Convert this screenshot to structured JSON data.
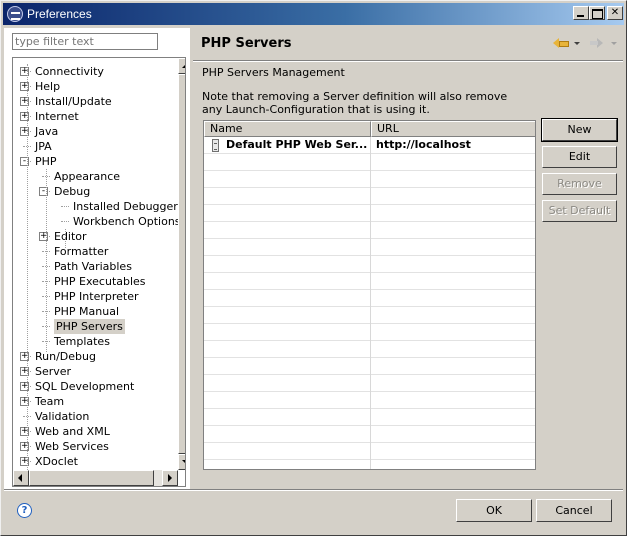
{
  "window": {
    "title": "Preferences"
  },
  "filter": {
    "placeholder": "type filter text"
  },
  "tree": [
    {
      "label": "Connectivity",
      "level": 0,
      "toggle": "+"
    },
    {
      "label": "Help",
      "level": 0,
      "toggle": "+"
    },
    {
      "label": "Install/Update",
      "level": 0,
      "toggle": "+"
    },
    {
      "label": "Internet",
      "level": 0,
      "toggle": "+"
    },
    {
      "label": "Java",
      "level": 0,
      "toggle": "+"
    },
    {
      "label": "JPA",
      "level": 0,
      "toggle": ""
    },
    {
      "label": "PHP",
      "level": 0,
      "toggle": "-"
    },
    {
      "label": "Appearance",
      "level": 1,
      "toggle": ""
    },
    {
      "label": "Debug",
      "level": 1,
      "toggle": "-"
    },
    {
      "label": "Installed Debuggers",
      "level": 2,
      "toggle": ""
    },
    {
      "label": "Workbench Options",
      "level": 2,
      "toggle": ""
    },
    {
      "label": "Editor",
      "level": 1,
      "toggle": "+"
    },
    {
      "label": "Formatter",
      "level": 1,
      "toggle": ""
    },
    {
      "label": "Path Variables",
      "level": 1,
      "toggle": ""
    },
    {
      "label": "PHP Executables",
      "level": 1,
      "toggle": ""
    },
    {
      "label": "PHP Interpreter",
      "level": 1,
      "toggle": ""
    },
    {
      "label": "PHP Manual",
      "level": 1,
      "toggle": ""
    },
    {
      "label": "PHP Servers",
      "level": 1,
      "toggle": "",
      "selected": true
    },
    {
      "label": "Templates",
      "level": 1,
      "toggle": ""
    },
    {
      "label": "Run/Debug",
      "level": 0,
      "toggle": "+"
    },
    {
      "label": "Server",
      "level": 0,
      "toggle": "+"
    },
    {
      "label": "SQL Development",
      "level": 0,
      "toggle": "+"
    },
    {
      "label": "Team",
      "level": 0,
      "toggle": "+"
    },
    {
      "label": "Validation",
      "level": 0,
      "toggle": ""
    },
    {
      "label": "Web and XML",
      "level": 0,
      "toggle": "+"
    },
    {
      "label": "Web Services",
      "level": 0,
      "toggle": "+"
    },
    {
      "label": "XDoclet",
      "level": 0,
      "toggle": "+"
    }
  ],
  "page": {
    "title": "PHP Servers",
    "section": "PHP Servers Management",
    "note": "Note that removing a Server definition will also remove any Launch-Configuration that is using it."
  },
  "table": {
    "columns": [
      "Name",
      "URL"
    ],
    "rows": [
      {
        "name": "Default PHP Web Ser...",
        "url": "http://localhost"
      }
    ]
  },
  "buttons": {
    "new": "New",
    "edit": "Edit",
    "remove": "Remove",
    "set_default": "Set Default",
    "ok": "OK",
    "cancel": "Cancel"
  },
  "icons": {
    "help": "?"
  }
}
